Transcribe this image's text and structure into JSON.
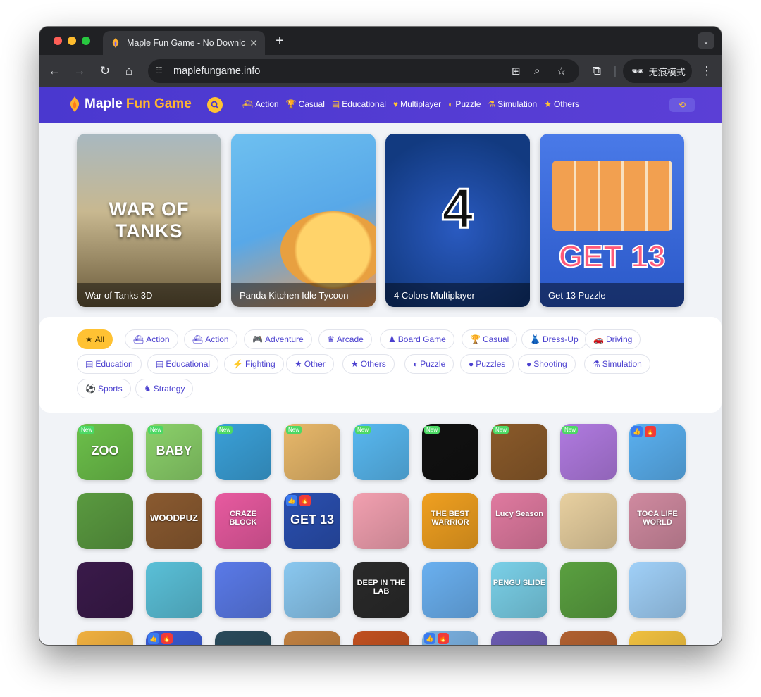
{
  "browser": {
    "tab_title": "Maple Fun Game - No Downlo",
    "url": "maplefungame.info",
    "incognito_label": "无痕模式"
  },
  "site": {
    "logo_main": "Maple",
    "logo_accent": "Fun Game",
    "nav": [
      {
        "label": "Action",
        "icon": "ship-icon"
      },
      {
        "label": "Casual",
        "icon": "trophy-icon"
      },
      {
        "label": "Educational",
        "icon": "book-icon"
      },
      {
        "label": "Multiplayer",
        "icon": "heart-icon"
      },
      {
        "label": "Puzzle",
        "icon": "puzzle-icon"
      },
      {
        "label": "Simulation",
        "icon": "flask-icon"
      },
      {
        "label": "Others",
        "icon": "star-icon"
      }
    ]
  },
  "featured": [
    {
      "title": "War of Tanks 3D",
      "art_text": "WAR OF TANKS",
      "color": "#8a7a4a"
    },
    {
      "title": "Panda Kitchen Idle Tycoon",
      "color": "#4ea8e8"
    },
    {
      "title": "4 Colors Multiplayer",
      "art_text": "4",
      "color": "#1f4fa0"
    },
    {
      "title": "Get 13 Puzzle",
      "art_text": "GET 13",
      "color": "#3a6fd8"
    }
  ],
  "categories": [
    {
      "label": "All",
      "icon": "★",
      "active": true
    },
    {
      "label": "Action",
      "icon": "⛴"
    },
    {
      "label": "Action",
      "icon": "⛴"
    },
    {
      "label": "Adventure",
      "icon": "🎮"
    },
    {
      "label": "Arcade",
      "icon": "♛"
    },
    {
      "label": "Board Game",
      "icon": "♟"
    },
    {
      "label": "Casual",
      "icon": "🏆"
    },
    {
      "label": "Dress-Up",
      "icon": "👗"
    },
    {
      "label": "Driving",
      "icon": "🚗"
    },
    {
      "label": "Education",
      "icon": "▤"
    },
    {
      "label": "Educational",
      "icon": "▤"
    },
    {
      "label": "Fighting",
      "icon": "⚡"
    },
    {
      "label": "Other",
      "icon": "★"
    },
    {
      "label": "Others",
      "icon": "★"
    },
    {
      "label": "Puzzle",
      "icon": "◐"
    },
    {
      "label": "Puzzles",
      "icon": "●"
    },
    {
      "label": "Shooting",
      "icon": "●"
    },
    {
      "label": "Simulation",
      "icon": "⚗"
    },
    {
      "label": "Sports",
      "icon": "⚽"
    },
    {
      "label": "Strategy",
      "icon": "♞"
    }
  ],
  "game_thumbs": [
    {
      "color": "#6cc04a",
      "new": true,
      "text": "ZOO"
    },
    {
      "color": "#8bd16a",
      "new": true,
      "text": "BABY"
    },
    {
      "color": "#3aa0d8",
      "new": true,
      "text": ""
    },
    {
      "color": "#e8b86a",
      "new": true,
      "text": ""
    },
    {
      "color": "#58b8f0",
      "new": true,
      "text": ""
    },
    {
      "color": "#111111",
      "new": true,
      "text": ""
    },
    {
      "color": "#8a5a2a",
      "new": true,
      "text": ""
    },
    {
      "color": "#b07ae0",
      "new": true,
      "text": ""
    },
    {
      "color": "#5ab0f0",
      "like": true,
      "text": ""
    },
    {
      "color": "#5a9a40",
      "text": ""
    },
    {
      "color": "#8a5a30",
      "text": "WOODPUZ"
    },
    {
      "color": "#e85aa0",
      "text": "CRAZE BLOCK"
    },
    {
      "color": "#2a4fb0",
      "like": true,
      "text": "GET 13"
    },
    {
      "color": "#f2a0b0",
      "text": ""
    },
    {
      "color": "#f0a020",
      "text": "THE BEST WARRIOR"
    },
    {
      "color": "#e07aa0",
      "text": "Lucy Season"
    },
    {
      "color": "#e8d0a0",
      "text": ""
    },
    {
      "color": "#d08aa0",
      "text": "TOCA LIFE WORLD"
    },
    {
      "color": "#3a1a4a",
      "text": ""
    },
    {
      "color": "#5ac0d8",
      "text": ""
    },
    {
      "color": "#5a7ae8",
      "text": ""
    },
    {
      "color": "#8ac8f0",
      "text": ""
    },
    {
      "color": "#2a2a2a",
      "text": "DEEP IN THE LAB"
    },
    {
      "color": "#6ab0f0",
      "text": ""
    },
    {
      "color": "#7ad0e8",
      "text": "PENGU SLIDE"
    },
    {
      "color": "#5aa040",
      "text": ""
    },
    {
      "color": "#a0d0f8",
      "text": ""
    },
    {
      "color": "#f0b040",
      "text": ""
    },
    {
      "color": "#3a5ad0",
      "like": true,
      "text": ""
    },
    {
      "color": "#2a4a5a",
      "text": ""
    },
    {
      "color": "#c08040",
      "text": ""
    },
    {
      "color": "#c05020",
      "text": ""
    },
    {
      "color": "#7ab0e0",
      "like": true,
      "text": ""
    },
    {
      "color": "#6a5ab0",
      "text": ""
    },
    {
      "color": "#b06030",
      "text": ""
    },
    {
      "color": "#f0c040",
      "text": ""
    }
  ]
}
